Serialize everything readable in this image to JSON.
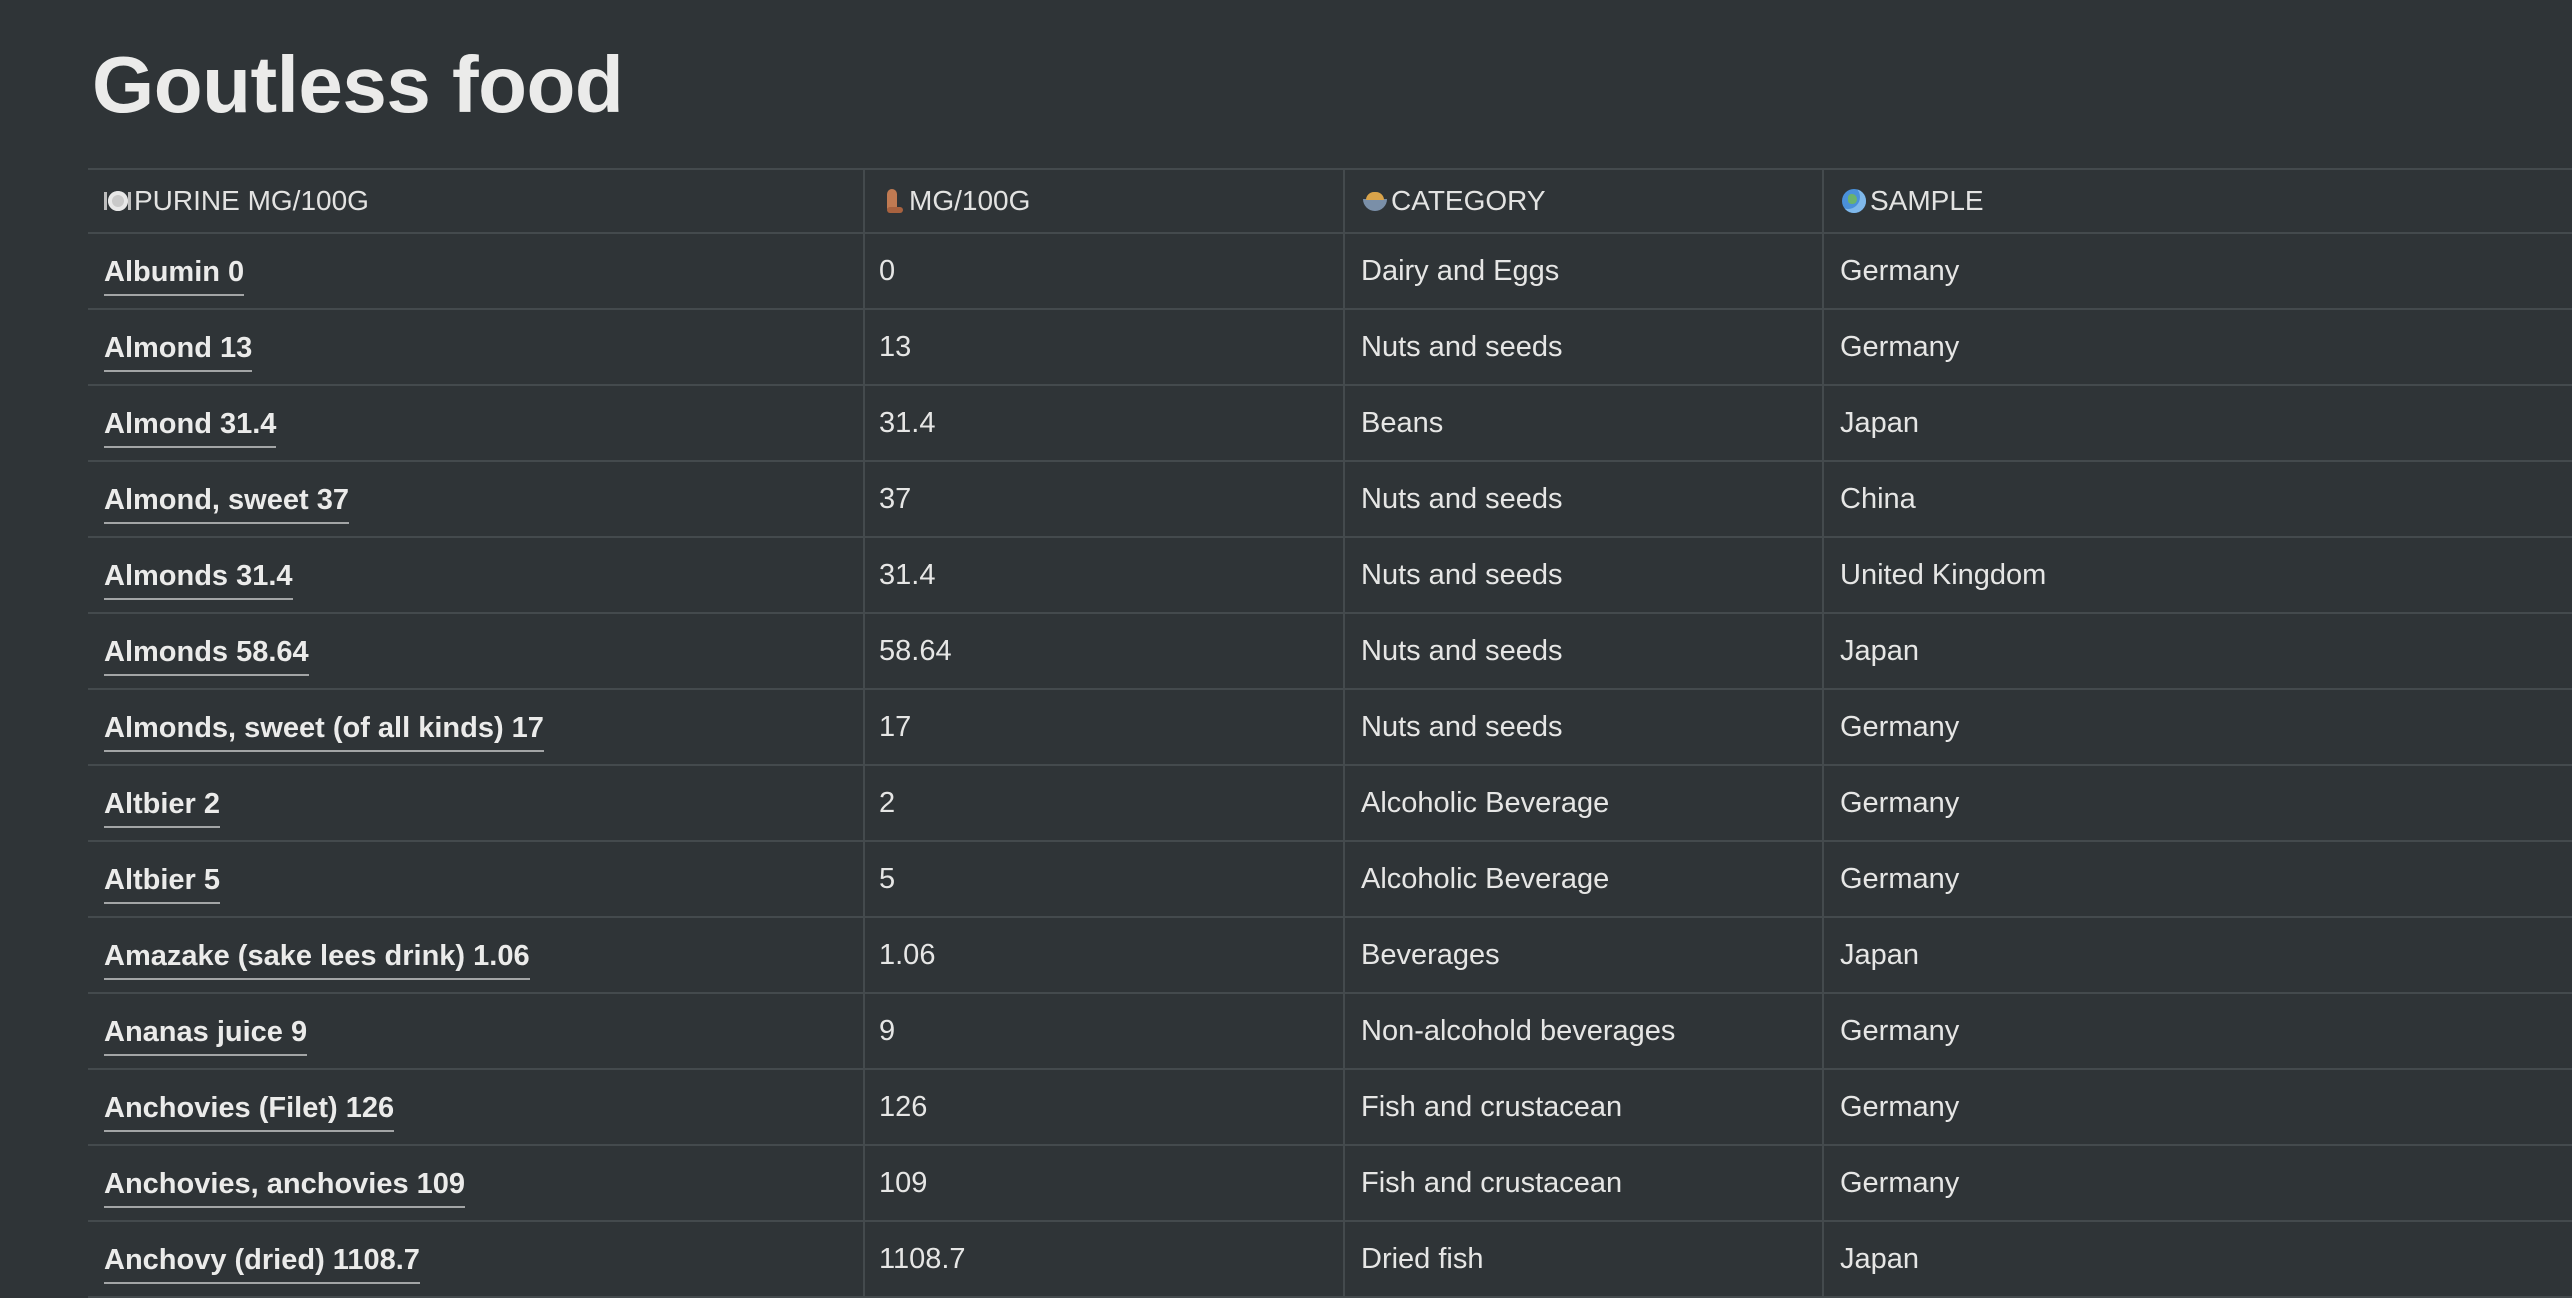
{
  "page": {
    "title": "Goutless food"
  },
  "columns": [
    {
      "icon": "plate-icon",
      "label": "PURINE MG/100G"
    },
    {
      "icon": "foot-icon",
      "label": "MG/100G"
    },
    {
      "icon": "bowl-icon",
      "label": "CATEGORY"
    },
    {
      "icon": "globe-icon",
      "label": "SAMPLE"
    }
  ],
  "rows": [
    {
      "name": "Albumin 0",
      "mg": "0",
      "category": "Dairy and Eggs",
      "sample": "Germany"
    },
    {
      "name": "Almond 13",
      "mg": "13",
      "category": "Nuts and seeds",
      "sample": "Germany"
    },
    {
      "name": "Almond 31.4",
      "mg": "31.4",
      "category": "Beans",
      "sample": "Japan"
    },
    {
      "name": "Almond, sweet 37",
      "mg": "37",
      "category": "Nuts and seeds",
      "sample": "China"
    },
    {
      "name": "Almonds 31.4",
      "mg": "31.4",
      "category": "Nuts and seeds",
      "sample": "United Kingdom"
    },
    {
      "name": "Almonds 58.64",
      "mg": "58.64",
      "category": "Nuts and seeds",
      "sample": "Japan"
    },
    {
      "name": "Almonds, sweet (of all kinds) 17",
      "mg": "17",
      "category": "Nuts and seeds",
      "sample": "Germany"
    },
    {
      "name": "Altbier 2",
      "mg": "2",
      "category": "Alcoholic Beverage",
      "sample": "Germany"
    },
    {
      "name": "Altbier 5",
      "mg": "5",
      "category": "Alcoholic Beverage",
      "sample": "Germany"
    },
    {
      "name": "Amazake (sake lees drink) 1.06",
      "mg": "1.06",
      "category": "Beverages",
      "sample": "Japan"
    },
    {
      "name": "Ananas juice 9",
      "mg": "9",
      "category": "Non-alcohold beverages",
      "sample": "Germany"
    },
    {
      "name": "Anchovies (Filet) 126",
      "mg": "126",
      "category": "Fish and crustacean",
      "sample": "Germany"
    },
    {
      "name": "Anchovies, anchovies 109",
      "mg": "109",
      "category": "Fish and crustacean",
      "sample": "Germany"
    },
    {
      "name": "Anchovy (dried) 1108.7",
      "mg": "1108.7",
      "category": "Dried fish",
      "sample": "Japan"
    }
  ]
}
